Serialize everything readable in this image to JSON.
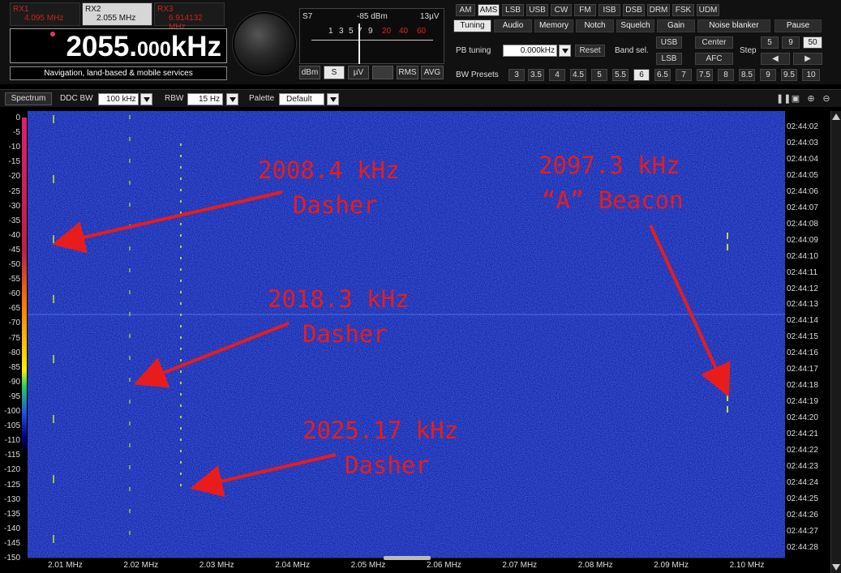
{
  "receivers": [
    {
      "name": "RX1",
      "freq": "4.095 MHz",
      "active": false
    },
    {
      "name": "RX2",
      "freq": "2.055 MHz",
      "active": true
    },
    {
      "name": "RX3",
      "freq": "6.914132 MHz",
      "active": false
    }
  ],
  "frequency": {
    "main": "2055.",
    "small": "000",
    "unit": "kHz"
  },
  "service_label": "Navigation, land-based & mobile services",
  "smeter": {
    "s_reading": "S7",
    "dbm_reading": "-85 dBm",
    "uv_reading": "13µV",
    "scale_white": [
      "1",
      "3",
      "5",
      "7",
      "9"
    ],
    "scale_red": [
      "20",
      "40",
      "60"
    ],
    "unit_buttons": [
      "dBm",
      "S",
      "µV",
      "RMS",
      "AVG"
    ],
    "active_unit": "S"
  },
  "modes": [
    "AM",
    "AMS",
    "LSB",
    "USB",
    "CW",
    "FM",
    "ISB",
    "DSB",
    "DRM",
    "FSK",
    "UDM"
  ],
  "active_mode": "AMS",
  "tabs": [
    "Tuning",
    "Audio",
    "Memory",
    "Notch",
    "Squelch",
    "Gain",
    "Noise blanker",
    "Pause"
  ],
  "active_tab": "Tuning",
  "tuning": {
    "pb_label": "PB tuning",
    "pb_value": "0.000kHz",
    "reset": "Reset",
    "band_sel_label": "Band sel.",
    "usb": "USB",
    "lsb": "LSB",
    "center": "Center",
    "afc": "AFC",
    "step_label": "Step",
    "steps": [
      "5",
      "9",
      "50"
    ],
    "active_step": "50",
    "step_left": "◀",
    "step_right": "▶",
    "bw_label": "BW Presets",
    "bw_presets": [
      "3",
      "3.5",
      "4",
      "4.5",
      "5",
      "5.5",
      "6",
      "6.5",
      "7",
      "7.5",
      "8",
      "8.5",
      "9",
      "9.5",
      "10"
    ],
    "active_bw": "6"
  },
  "spectrum_bar": {
    "spectrum_button": "Spectrum",
    "ddc_label": "DDC BW",
    "ddc_value": "100 kHz",
    "rbw_label": "RBW",
    "rbw_value": "15 Hz",
    "palette_label": "Palette",
    "palette_value": "Default"
  },
  "db_scale": [
    "0",
    "-5",
    "-10",
    "-15",
    "-20",
    "-25",
    "-30",
    "-35",
    "-40",
    "-45",
    "-50",
    "-55",
    "-60",
    "-65",
    "-70",
    "-75",
    "-80",
    "-85",
    "-90",
    "-95",
    "-100",
    "-105",
    "-110",
    "-115",
    "-120",
    "-125",
    "-130",
    "-135",
    "-140",
    "-145",
    "-150"
  ],
  "timestamps": [
    "02:44:02",
    "02:44:03",
    "02:44:04",
    "02:44:05",
    "02:44:06",
    "02:44:07",
    "02:44:08",
    "02:44:09",
    "02:44:10",
    "02:44:11",
    "02:44:12",
    "02:44:13",
    "02:44:14",
    "02:44:15",
    "02:44:16",
    "02:44:17",
    "02:44:18",
    "02:44:19",
    "02:44:20",
    "02:44:21",
    "02:44:22",
    "02:44:23",
    "02:44:24",
    "02:44:25",
    "02:44:26",
    "02:44:27",
    "02:44:28"
  ],
  "freq_axis": [
    "2.01 MHz",
    "2.02 MHz",
    "2.03 MHz",
    "2.04 MHz",
    "2.05 MHz",
    "2.06 MHz",
    "2.07 MHz",
    "2.08 MHz",
    "2.09 MHz",
    "2.10 MHz"
  ],
  "annotations": [
    {
      "line1": "2008.4 kHz",
      "line2": "Dasher"
    },
    {
      "line1": "2018.3 kHz",
      "line2": "Dasher"
    },
    {
      "line1": "2025.17 kHz",
      "line2": "Dasher"
    },
    {
      "line1": "2097.3 kHz",
      "line2": "“A” Beacon"
    }
  ],
  "colors": {
    "waterfall_bg": "#1c2fb4",
    "annotation": "#e81c1c",
    "signal_trace": "#c8e830",
    "active_button": "#e8e8e8"
  }
}
